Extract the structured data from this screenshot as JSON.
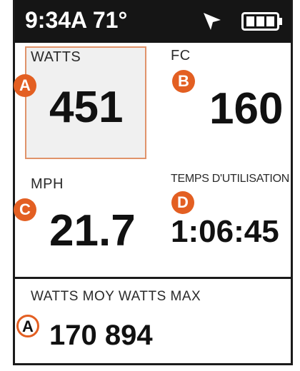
{
  "status": {
    "time_temp": "9:34A 71°",
    "nav_icon": "navigation-arrow-icon",
    "battery_icon": "battery-full-icon"
  },
  "fields": {
    "watts": {
      "label": "WATTS",
      "value": "451",
      "badge": "A"
    },
    "fc": {
      "label": "FC",
      "value": "160",
      "badge": "B"
    },
    "mph": {
      "label": "MPH",
      "value": "21.7",
      "badge": "C"
    },
    "temps": {
      "label": "TEMPS D'UTILISATION",
      "value": "1:06:45",
      "badge": "D"
    }
  },
  "bottom": {
    "label": "WATTS MOY WATTS MAX",
    "value": "170 894",
    "badge": "A"
  },
  "colors": {
    "badge": "#e35f22",
    "highlight_border": "#e0936a",
    "status_bar": "#151515"
  }
}
